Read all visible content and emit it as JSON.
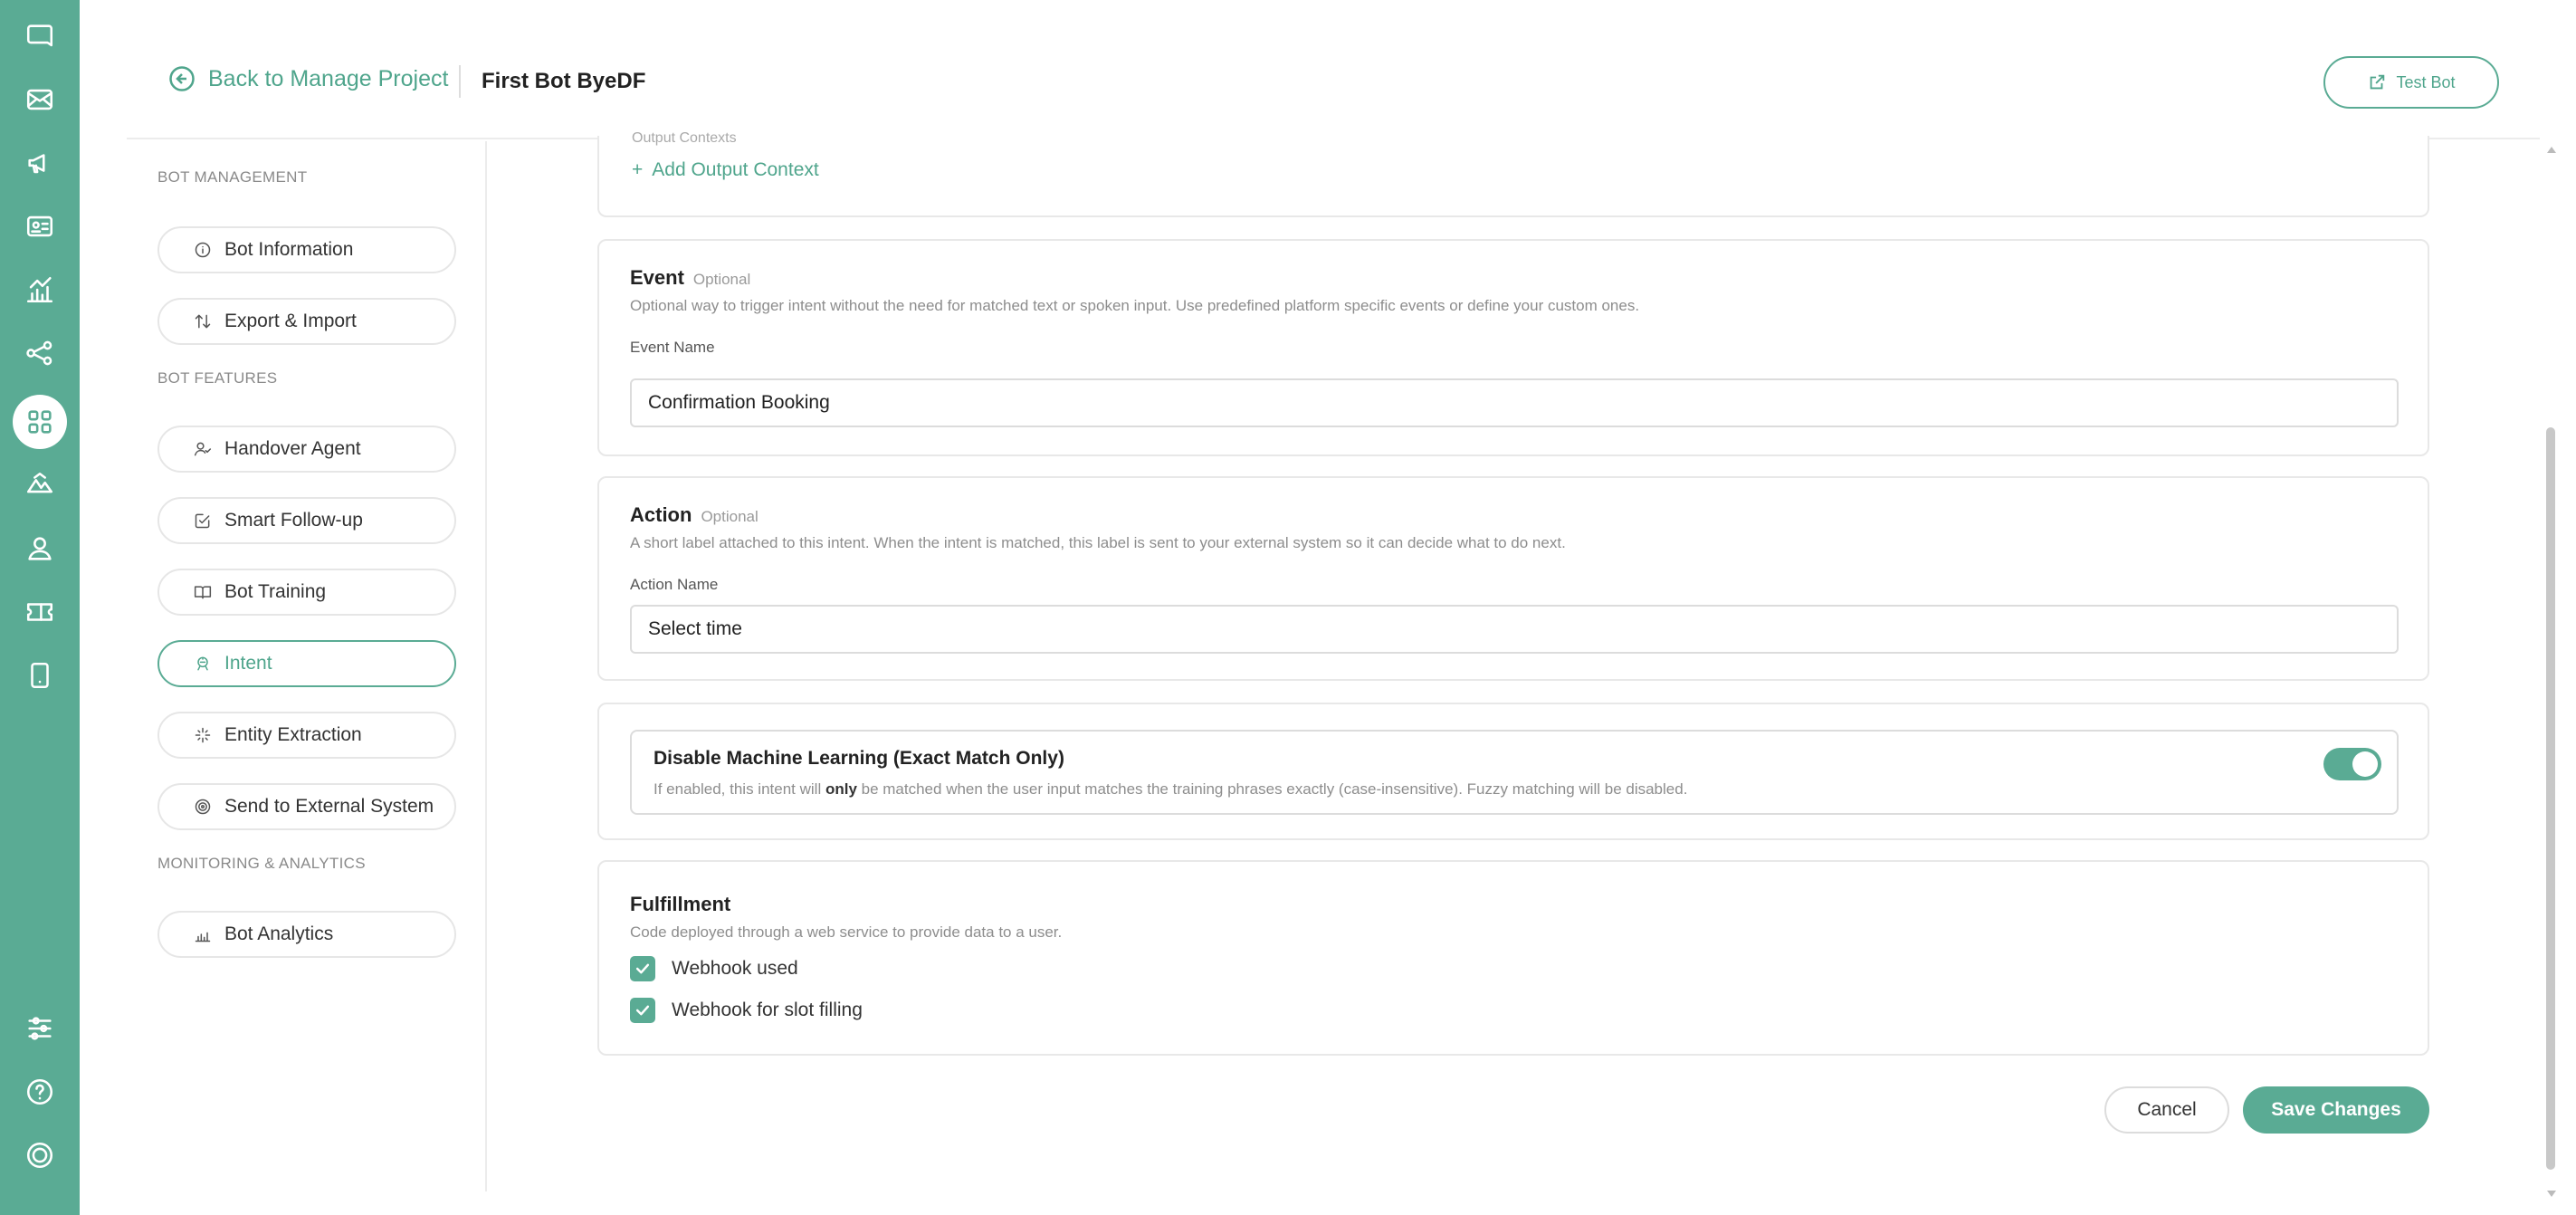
{
  "rail": {
    "icons": [
      "chat-icon",
      "mail-icon",
      "megaphone-icon",
      "contact-card-icon",
      "analytics-icon",
      "share-nodes-icon",
      "apps-grid-icon",
      "integration-icon",
      "user-icon",
      "ticket-icon",
      "mobile-icon",
      "sliders-icon",
      "help-icon",
      "power-icon"
    ],
    "active": "apps-grid-icon"
  },
  "header": {
    "back_label": "Back to Manage Project",
    "bot_name": "First Bot ByeDF",
    "test_bot_label": "Test Bot"
  },
  "sidemenu": {
    "sections": {
      "bot_management": "BOT MANAGEMENT",
      "bot_features": "BOT FEATURES",
      "monitoring": "MONITORING & ANALYTICS"
    },
    "items": [
      {
        "label": "Bot Information",
        "icon": "info-icon"
      },
      {
        "label": "Export & Import",
        "icon": "swap-arrows-icon"
      },
      {
        "label": "Handover Agent",
        "icon": "handover-icon"
      },
      {
        "label": "Smart Follow-up",
        "icon": "edit-check-icon"
      },
      {
        "label": "Bot Training",
        "icon": "book-icon"
      },
      {
        "label": "Intent",
        "icon": "intent-icon",
        "active": true
      },
      {
        "label": "Entity Extraction",
        "icon": "sparkle-icon"
      },
      {
        "label": "Send to External System",
        "icon": "target-icon"
      },
      {
        "label": "Bot Analytics",
        "icon": "bar-chart-icon"
      }
    ]
  },
  "output_context": {
    "cut_label": "Output Contexts",
    "add_label": "Add Output Context"
  },
  "event": {
    "title": "Event",
    "optional": "Optional",
    "description": "Optional way to trigger intent without the need for matched text or spoken input. Use predefined platform specific events or define your custom ones.",
    "field_label": "Event Name",
    "value": "Confirmation Booking"
  },
  "action": {
    "title": "Action",
    "optional": "Optional",
    "description": "A short label attached to this intent. When the intent is matched, this label is sent to your external system so it can decide what to do next.",
    "field_label": "Action Name",
    "value": "Select time"
  },
  "ml": {
    "title": "Disable Machine Learning (Exact Match Only)",
    "desc_before": "If enabled, this intent will ",
    "desc_bold": "only",
    "desc_after": " be matched when the user input matches the training phrases exactly (case-insensitive). Fuzzy matching will be disabled.",
    "enabled": true
  },
  "fulfillment": {
    "title": "Fulfillment",
    "description": "Code deployed through a web service to provide data to a user.",
    "checkboxes": [
      {
        "label": "Webhook used",
        "checked": true
      },
      {
        "label": "Webhook for slot filling",
        "checked": true
      }
    ]
  },
  "actions": {
    "cancel": "Cancel",
    "save": "Save Changes"
  },
  "colors": {
    "accent": "#5aab94",
    "accent_text": "#4fa58c"
  }
}
